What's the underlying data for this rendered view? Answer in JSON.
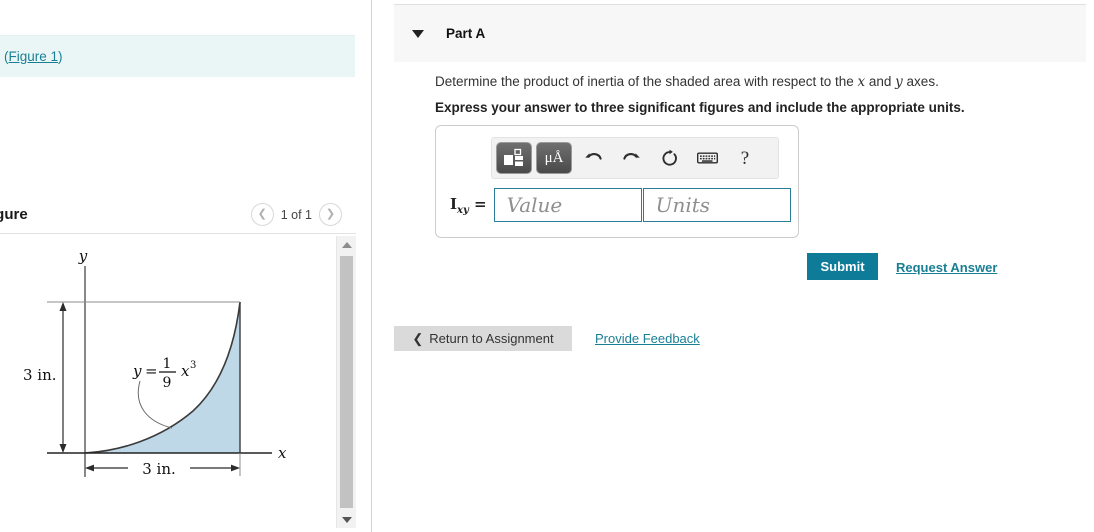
{
  "left": {
    "reference": {
      "link_text": "Figure 1",
      "prefix": "(",
      "suffix": ")"
    },
    "figure_panel": {
      "title": "igure",
      "pager_label": "1 of 1",
      "prev_icon": "chevron-left-icon",
      "next_icon": "chevron-right-icon",
      "scrollbar_up_icon": "triangle-up-icon",
      "scrollbar_down_icon": "triangle-down-icon"
    },
    "figure": {
      "y_axis_label": "y",
      "x_axis_label": "x",
      "curve_equation_y": "y",
      "curve_equation_eq": "=",
      "curve_equation_num": "1",
      "curve_equation_den": "9",
      "curve_equation_var": "x",
      "curve_equation_exp": "3",
      "vertical_dimension": "3 in.",
      "horizontal_dimension": "3 in.",
      "shade_color": "#bfd8e8",
      "curve_color": "#404040"
    }
  },
  "right": {
    "part": {
      "title": "Part A",
      "caret_icon": "caret-down-icon"
    },
    "prompt": {
      "line1_a": "Determine the product of inertia of the shaded area with respect to the ",
      "line1_x": "x",
      "line1_b": " and ",
      "line1_y": "y",
      "line1_c": " axes.",
      "line2": "Express your answer to three significant figures and include the appropriate units."
    },
    "toolbar": {
      "template_icon": "math-template-icon",
      "units_label": "μÅ",
      "units_icon": "units-icon",
      "undo_icon": "undo-arrow-icon",
      "redo_icon": "redo-arrow-icon",
      "reset_icon": "reset-circle-icon",
      "keyboard_icon": "keyboard-icon",
      "help_label": "?",
      "help_icon": "question-mark-icon"
    },
    "answer": {
      "label_main": "I",
      "label_sub": "xy",
      "label_eq": "=",
      "value_placeholder": "Value",
      "units_placeholder": "Units",
      "value_current": "",
      "units_current": ""
    },
    "actions": {
      "submit_label": "Submit",
      "request_answer_label": "Request Answer",
      "return_label": "Return to Assignment",
      "return_icon": "chevron-left-icon",
      "feedback_label": "Provide Feedback"
    },
    "colors": {
      "accent": "#0e7c99",
      "link": "#1a7f94",
      "header_bg": "#f7f7f7"
    }
  }
}
